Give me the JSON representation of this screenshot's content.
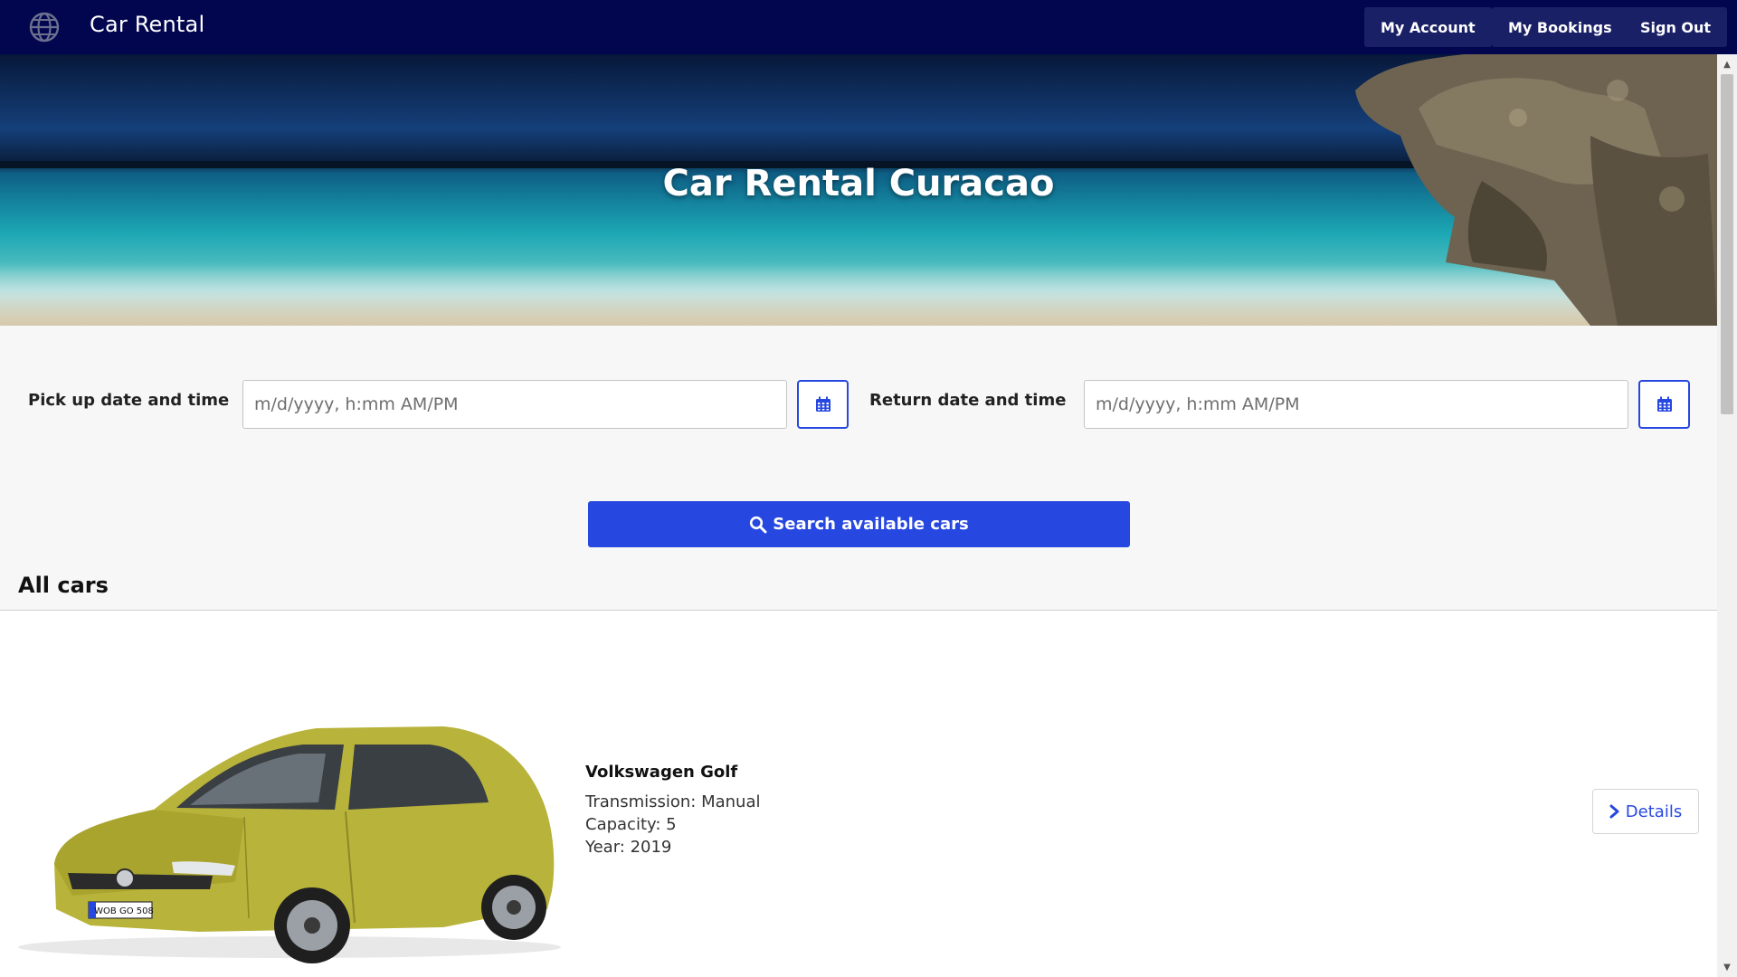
{
  "navbar": {
    "brand_icon": "globe-icon",
    "brand_title": "Car Rental",
    "buttons": [
      "My Account",
      "My Bookings",
      "Sign Out"
    ]
  },
  "hero": {
    "title": "Car Rental Curacao"
  },
  "search": {
    "pickup_label": "Pick up date and time",
    "pickup_placeholder": "m/d/yyyy, h:mm AM/PM",
    "return_label": "Return date and time",
    "return_placeholder": "m/d/yyyy, h:mm AM/PM",
    "calendar_icon": "calendar-icon",
    "search_icon": "search-icon",
    "search_button": "Search available cars"
  },
  "cars_section": {
    "title": "All cars"
  },
  "cars": [
    {
      "name": "Volkswagen Golf",
      "transmission": "Transmission: Manual",
      "capacity": "Capacity: 5",
      "year": "Year: 2019",
      "details_icon": "chevron-right-icon",
      "details_button": "Details",
      "plate": "WOB GO 508"
    }
  ],
  "colors": {
    "navbar": "#02064f",
    "accent": "#2748e0",
    "car_body": "#b8b33a"
  }
}
